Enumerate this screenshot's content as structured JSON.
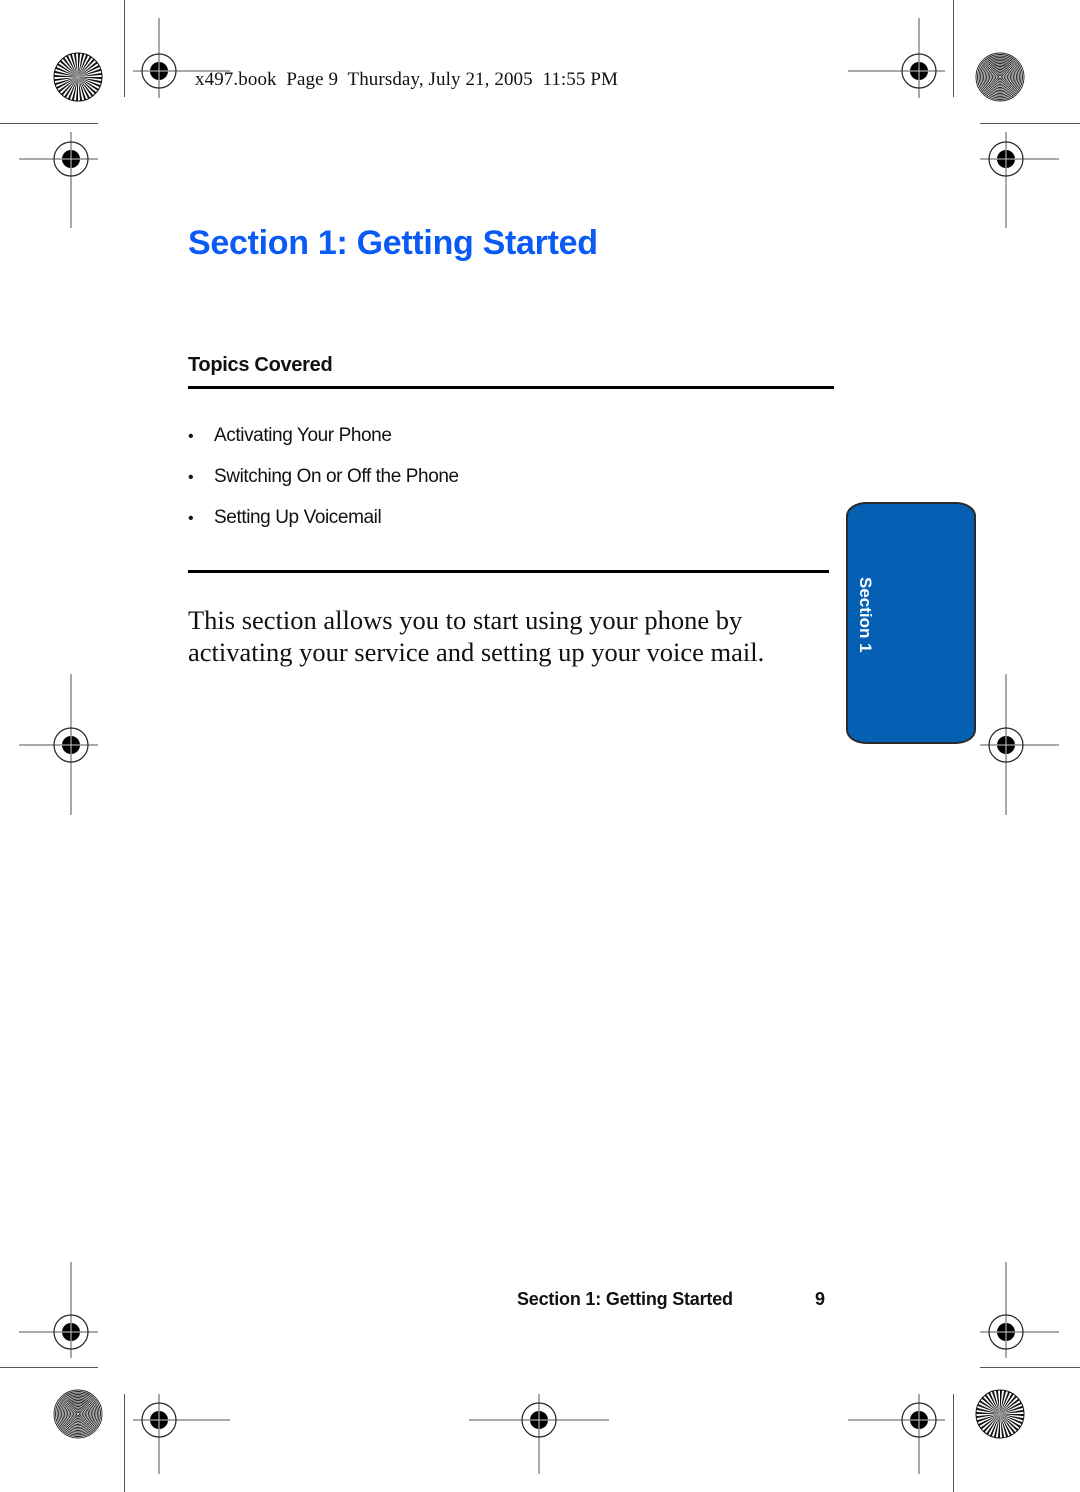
{
  "header": {
    "slug": "x497.book  Page 9  Thursday, July 21, 2005  11:55 PM"
  },
  "main": {
    "section_title": "Section 1: Getting Started",
    "topics_heading": "Topics Covered",
    "topics": [
      "Activating Your Phone",
      "Switching On or Off the Phone",
      "Setting Up Voicemail"
    ],
    "bullet_glyph": "•",
    "intro": "This section allows you to start using your phone by activating your service and setting up your voice mail."
  },
  "side_tab": {
    "label": "Section 1",
    "color": "#0560b4"
  },
  "footer": {
    "running_title": "Section 1: Getting Started",
    "page_number": "9"
  },
  "colors": {
    "title": "#0a5af5",
    "text": "#111111"
  }
}
